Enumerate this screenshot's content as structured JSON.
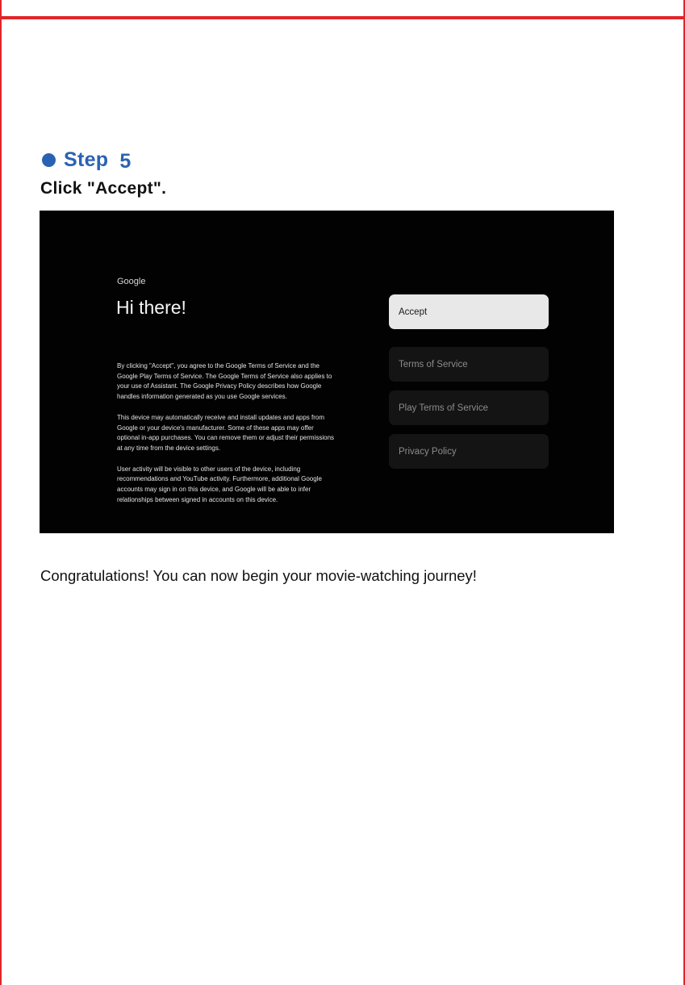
{
  "step": {
    "word": "Step",
    "number": "5",
    "instruction": "Click \"Accept\"."
  },
  "screen": {
    "brand": "Google",
    "title": "Hi there!",
    "paragraphs": [
      "By clicking \"Accept\", you agree to the Google Terms of Service and the Google Play Terms of Service. The Google Terms of Service also applies to your use of Assistant. The Google Privacy Policy describes how Google handles information generated as you use Google services.",
      "This device may automatically receive and install updates and apps from Google or your device's manufacturer. Some of these apps may offer optional in-app purchases. You can remove them or adjust their permissions at any time from the device settings.",
      "User activity will be visible to other users of the device, including recommendations and YouTube activity. Furthermore, additional Google accounts may sign in on this device, and Google will be able to infer relationships between signed in accounts on this device."
    ],
    "menu": [
      {
        "label": "Accept",
        "selected": true
      },
      {
        "label": "Terms of Service",
        "selected": false
      },
      {
        "label": "Play Terms of Service",
        "selected": false
      },
      {
        "label": "Privacy Policy",
        "selected": false
      }
    ]
  },
  "congrats": "Congratulations! You can now begin your movie-watching journey!",
  "colors": {
    "accent_red": "#e0262b",
    "step_blue": "#2a62b3",
    "screen_bg": "#020202"
  }
}
